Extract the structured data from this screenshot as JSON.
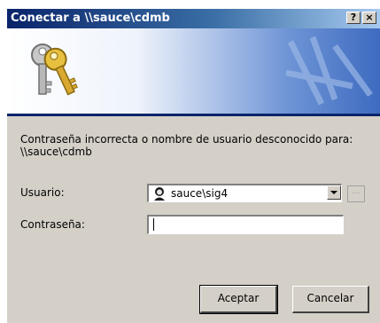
{
  "window": {
    "title": "Conectar a \\\\sauce\\cdmb",
    "help_label": "?",
    "close_label": "×"
  },
  "banner": {
    "icon": "keys-icon"
  },
  "message": "Contraseña incorrecta o nombre de usuario desconocido para: \\\\sauce\\cdmb",
  "form": {
    "user_label": "Usuario:",
    "user_value": "sauce\\sig4",
    "user_icon": "user-account-icon",
    "browse_label": "...",
    "password_label": "Contraseña:",
    "password_value": ""
  },
  "buttons": {
    "ok_label": "Aceptar",
    "cancel_label": "Cancelar"
  },
  "colors": {
    "titlebar_start": "#0a246a",
    "titlebar_end": "#a6caf0",
    "dialog_face": "#d4d0c8"
  }
}
